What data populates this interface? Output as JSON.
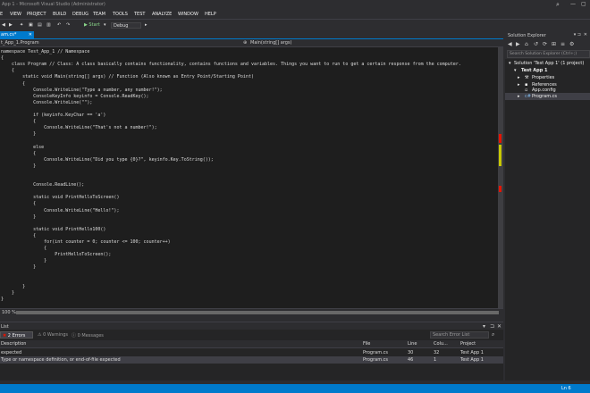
{
  "window": {
    "title": "App 1 - Microsoft Visual Studio (Administrator)"
  },
  "menu": [
    "E",
    "VIEW",
    "PROJECT",
    "BUILD",
    "DEBUG",
    "TEAM",
    "TOOLS",
    "TEST",
    "ANALYZE",
    "WINDOW",
    "HELP"
  ],
  "toolbar": {
    "start_label": "▶ Start",
    "config": "Debug"
  },
  "doc_tab": {
    "label": "am.cs*",
    "close": "✕"
  },
  "navbar": {
    "left": "t_App_1.Program",
    "right": "Main(string[] args)"
  },
  "editor": {
    "lines": [
      {
        "t": "namespace Test_App_1 // Namespace",
        "c": "cm"
      },
      {
        "t": "{"
      },
      {
        "t": "    class Program // Class: A class basically contains functionality, contains functions and variables. Things you want to run to get a certain response from the computer.",
        "c": "cm"
      },
      {
        "t": "    {"
      },
      {
        "t": "        static void Main(string[] args) // Function (Also known as Entry Point/Starting Point)",
        "c": "cm"
      },
      {
        "t": "        {"
      },
      {
        "t": "            Console.WriteLine(\"Type a number, any number!\");",
        "c": "st"
      },
      {
        "t": "            ConsoleKeyInfo keyinfo = Console.ReadKey();",
        "c": "ty"
      },
      {
        "t": "            Console.WriteLine(\"\");",
        "c": "st"
      },
      {
        "t": ""
      },
      {
        "t": "            if (keyinfo.KeyChar == 'a')",
        "c": "kw"
      },
      {
        "t": "            {"
      },
      {
        "t": "                Console.WriteLine(\"That's not a number!\");",
        "c": "st"
      },
      {
        "t": "            }"
      },
      {
        "t": ""
      },
      {
        "t": "            else",
        "c": "kw"
      },
      {
        "t": "            {"
      },
      {
        "t": "                Console.WriteLine(\"Did you type {0}?\", keyinfo.Key.ToString());",
        "c": "st"
      },
      {
        "t": "            }"
      },
      {
        "t": ""
      },
      {
        "t": ""
      },
      {
        "t": "            Console.ReadLine();",
        "c": "ty"
      },
      {
        "t": ""
      },
      {
        "t": "            static void PrintHelloToScreen()",
        "c": "kw"
      },
      {
        "t": "            {"
      },
      {
        "t": "                Console.WriteLine(\"Hello!\");",
        "c": "st"
      },
      {
        "t": "            }"
      },
      {
        "t": ""
      },
      {
        "t": "            static void PrintHello100()",
        "c": "kw"
      },
      {
        "t": "            {"
      },
      {
        "t": "                for(int counter = 0; counter <= 100; counter++)",
        "c": "kw"
      },
      {
        "t": "                {"
      },
      {
        "t": "                    PrintHelloToScreen();"
      },
      {
        "t": "                }"
      },
      {
        "t": "            }"
      },
      {
        "t": ""
      },
      {
        "t": ""
      },
      {
        "t": "        }"
      },
      {
        "t": "    }"
      },
      {
        "t": "}"
      }
    ],
    "zoom": "100 %"
  },
  "solution_explorer": {
    "title": "Solution Explorer",
    "pin": "▾ ⊐",
    "close": "✕",
    "toolbar": [
      "◀",
      "▶",
      "⌂",
      "↺",
      "⟳",
      "⊞",
      "≡",
      "⚙"
    ],
    "search_placeholder": "Search Solution Explorer (Ctrl+;)",
    "tree": [
      {
        "label": "Solution 'Test App 1' (1 project)",
        "indent": 1
      },
      {
        "label": "Test App 1",
        "indent": 2
      },
      {
        "label": "Properties",
        "indent": 3
      },
      {
        "label": "References",
        "indent": 3
      },
      {
        "label": "App.config",
        "indent": 3
      },
      {
        "label": "Program.cs",
        "indent": 3
      }
    ]
  },
  "error_list": {
    "title": "List",
    "errors_label": "2 Errors",
    "warnings_label": "0 Warnings",
    "messages_label": "0 Messages",
    "search_placeholder": "Search Error List",
    "columns": [
      "Description",
      "File",
      "Line",
      "Colu...",
      "Project"
    ],
    "rows": [
      {
        "desc": "expected",
        "file": "Program.cs",
        "line": "30",
        "col": "32",
        "project": "Test App 1"
      },
      {
        "desc": "Type or namespace definition, or end-of-file expected",
        "file": "Program.cs",
        "line": "46",
        "col": "1",
        "project": "Test App 1"
      }
    ]
  },
  "status": {
    "line": "Ln 6"
  },
  "colors": {
    "accent": "#007acc",
    "editor_bg": "#1e1e1e",
    "error_marker": "#e51400",
    "warning_marker": "#c8c800"
  }
}
